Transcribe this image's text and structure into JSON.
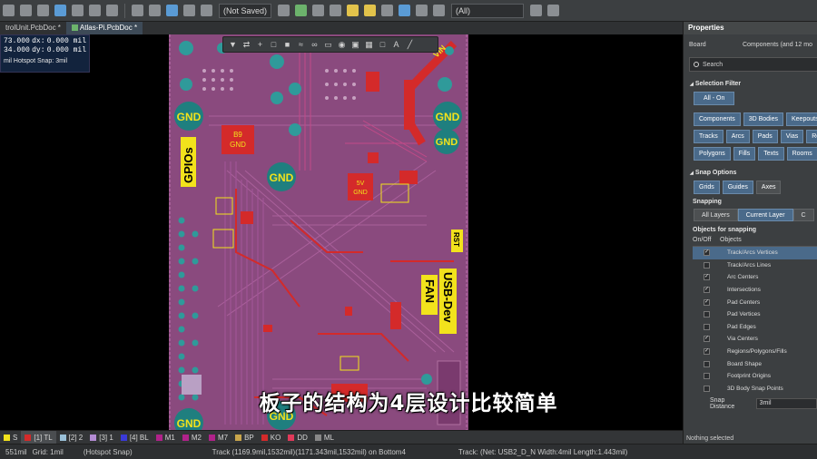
{
  "toolbar": {
    "variant": "(Not Saved)",
    "filter": "(All)"
  },
  "tabs": [
    {
      "label": "trolUnit.PcbDoc *"
    },
    {
      "label": "Atlas-Pi.PcbDoc *"
    }
  ],
  "hud": {
    "x": "73.000",
    "dx_label": "dx:",
    "dx": "0.000 mil",
    "y": "34.000",
    "dy_label": "dy:",
    "dy": "0.000 mil",
    "snap": "mil Hotspot Snap: 3mil"
  },
  "board": {
    "labels": {
      "gpios": "GPIOs",
      "gnd": "GND",
      "vin": "VIN",
      "fan": "FAN",
      "usb_dev": "USB-Dev",
      "rst": "RST",
      "chip_top": "B9",
      "chip_top_sub": "GND",
      "chip_mid": "5V",
      "chip_mid_sub": "GND"
    },
    "colors": {
      "board": "#8a4a7e",
      "copper_top": "#d42a2a",
      "silk": "#f2e21c",
      "pad": "#2f9a9a",
      "gnd_pad": "#1f7f7f"
    }
  },
  "subtitle": "板子的结构为4层设计比较简单",
  "layers": [
    {
      "label": "S",
      "color": "#f2e21c"
    },
    {
      "label": "[1] TL",
      "color": "#d42a2a",
      "active": true
    },
    {
      "label": "[2] 2",
      "color": "#9ac0d8"
    },
    {
      "label": "[3] 1",
      "color": "#b38bd3"
    },
    {
      "label": "[4] BL",
      "color": "#3a3ad8"
    },
    {
      "label": "M1",
      "color": "#b0228a"
    },
    {
      "label": "M2",
      "color": "#b0228a"
    },
    {
      "label": "M7",
      "color": "#b0228a"
    },
    {
      "label": "BP",
      "color": "#c9a64c"
    },
    {
      "label": "KO",
      "color": "#d42a2a"
    },
    {
      "label": "DD",
      "color": "#e03a5a"
    },
    {
      "label": "ML",
      "color": "#888888"
    }
  ],
  "status": {
    "coord": "551mil",
    "grid": "Grid: 1mil",
    "hotspot": "(Hotspot Snap)",
    "track": "Track (1169.9mil,1532mil)(1171.343mil,1532mil) on Bottom4",
    "net": "Track: (Net: USB2_D_N Width:4mil Length:1.443mil)"
  },
  "panel": {
    "title": "Properties",
    "board_label": "Board",
    "board_value": "Components (and 12 mo",
    "search_placeholder": "Search",
    "selection_filter_title": "Selection Filter",
    "all_on": "All - On",
    "filter_rows": [
      [
        "Components",
        "3D Bodies",
        "Keepouts"
      ],
      [
        "Tracks",
        "Arcs",
        "Pads",
        "Vias",
        "Regi"
      ],
      [
        "Polygons",
        "Fills",
        "Texts",
        "Rooms"
      ]
    ],
    "snap_options_title": "Snap Options",
    "snap_buttons": [
      "Grids",
      "Guides",
      "Axes"
    ],
    "snapping_label": "Snapping",
    "snapping_modes": [
      "All Layers",
      "Current Layer",
      "C"
    ],
    "objects_label": "Objects for snapping",
    "col_onoff": "On/Off",
    "col_objects": "Objects",
    "snap_objects": [
      {
        "label": "Track/Arcs Vertices",
        "checked": true,
        "selected": true
      },
      {
        "label": "Track/Arcs Lines",
        "checked": false
      },
      {
        "label": "Arc Centers",
        "checked": true
      },
      {
        "label": "Intersections",
        "checked": true
      },
      {
        "label": "Pad Centers",
        "checked": true
      },
      {
        "label": "Pad Vertices",
        "checked": false
      },
      {
        "label": "Pad Edges",
        "checked": false
      },
      {
        "label": "Via Centers",
        "checked": true
      },
      {
        "label": "Regions/Polygons/Fills",
        "checked": true
      },
      {
        "label": "Board Shape",
        "checked": false
      },
      {
        "label": "Footprint Origins",
        "checked": false
      },
      {
        "label": "3D Body Snap Points",
        "checked": false
      }
    ],
    "snap_distance_label": "Snap Distance",
    "snap_distance_value": "3mil",
    "nothing_selected": "Nothing selected"
  }
}
